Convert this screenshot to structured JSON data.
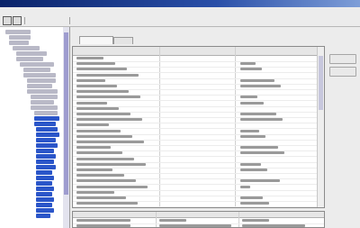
{
  "window": {
    "title": ""
  },
  "menu": [
    "",
    ""
  ],
  "toolbar": {
    "buttons": [
      "",
      "",
      "",
      "",
      "",
      "",
      "",
      ""
    ]
  },
  "tree": {
    "items": []
  },
  "tabs": [
    {
      "label": ""
    },
    {
      "label": ""
    }
  ],
  "grid": {
    "columns": [
      "",
      "",
      ""
    ],
    "rows": []
  },
  "details": {
    "columns": [
      "",
      "",
      ""
    ],
    "rows": []
  },
  "side_buttons": [
    "",
    "",
    ""
  ],
  "colors": {
    "selection": "#2b56c9",
    "title_bar": "#0a246a",
    "tree_scroll_thumb": "#9e9ccf"
  }
}
